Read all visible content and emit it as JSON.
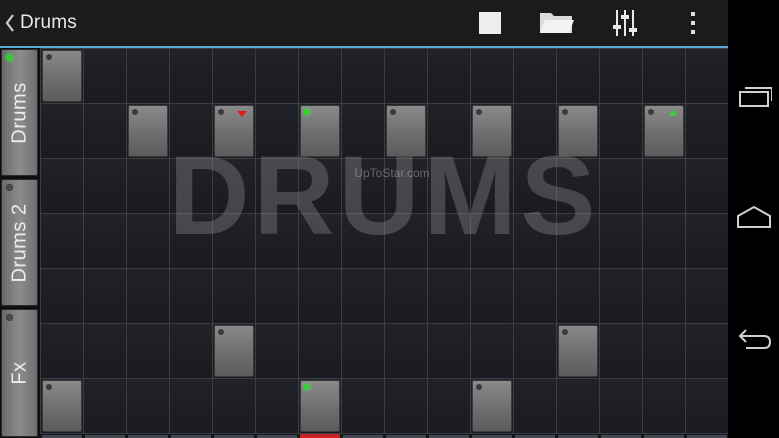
{
  "actionbar": {
    "title": "Drums",
    "back_icon": "chevron-left-icon",
    "actions": [
      "stop-icon",
      "folder-icon",
      "mixer-icon",
      "overflow-menu-icon"
    ]
  },
  "tracks": [
    {
      "label": "Drums",
      "active": true
    },
    {
      "label": "Drums 2",
      "active": false
    },
    {
      "label": "Fx",
      "active": false
    }
  ],
  "grid": {
    "rows": 7,
    "columns": 16,
    "pads": [
      {
        "row": 0,
        "col": 0,
        "led": false
      },
      {
        "row": 1,
        "col": 2,
        "led": false
      },
      {
        "row": 1,
        "col": 4,
        "led": false,
        "marker": "down"
      },
      {
        "row": 1,
        "col": 6,
        "led": true
      },
      {
        "row": 1,
        "col": 8,
        "led": false
      },
      {
        "row": 1,
        "col": 10,
        "led": false
      },
      {
        "row": 1,
        "col": 12,
        "led": false
      },
      {
        "row": 1,
        "col": 14,
        "led": false,
        "marker": "up"
      },
      {
        "row": 5,
        "col": 4,
        "led": false
      },
      {
        "row": 5,
        "col": 12,
        "led": false
      },
      {
        "row": 6,
        "col": 0,
        "led": false
      },
      {
        "row": 6,
        "col": 6,
        "led": true
      },
      {
        "row": 6,
        "col": 10,
        "led": false
      }
    ],
    "playhead_column": 6
  },
  "watermark": {
    "text": "DRUMS",
    "url": "UpToStar.com"
  },
  "navbar": {
    "icons": [
      "recent-apps-icon",
      "home-icon",
      "back-icon"
    ]
  },
  "colors": {
    "accent": "#5aa7d6",
    "led_on": "#33d033",
    "playhead": "#c42222"
  }
}
